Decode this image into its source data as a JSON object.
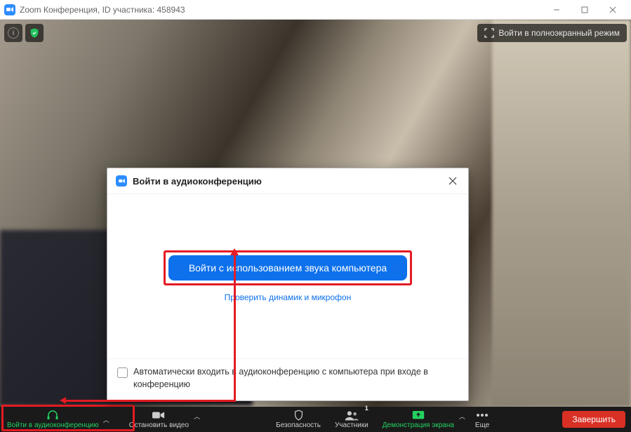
{
  "titlebar": {
    "title": "Zoom Конференция, ID участника: 458943"
  },
  "fullscreen": {
    "label": "Войти в полноэкранный режим"
  },
  "dialog": {
    "title": "Войти в аудиоконференцию",
    "primaryBtn": "Войти с использованием звука компьютера",
    "testLink": "Проверить динамик и микрофон",
    "autoJoinLabel": "Автоматически входить в аудиоконференцию с компьютера при входе в конференцию"
  },
  "toolbar": {
    "audio": "Войти в аудиоконференцию",
    "video": "Остановить видео",
    "security": "Безопасность",
    "participants": "Участники",
    "participantsCount": "1",
    "share": "Демонстрация экрана",
    "more": "Еще",
    "end": "Завершить"
  }
}
